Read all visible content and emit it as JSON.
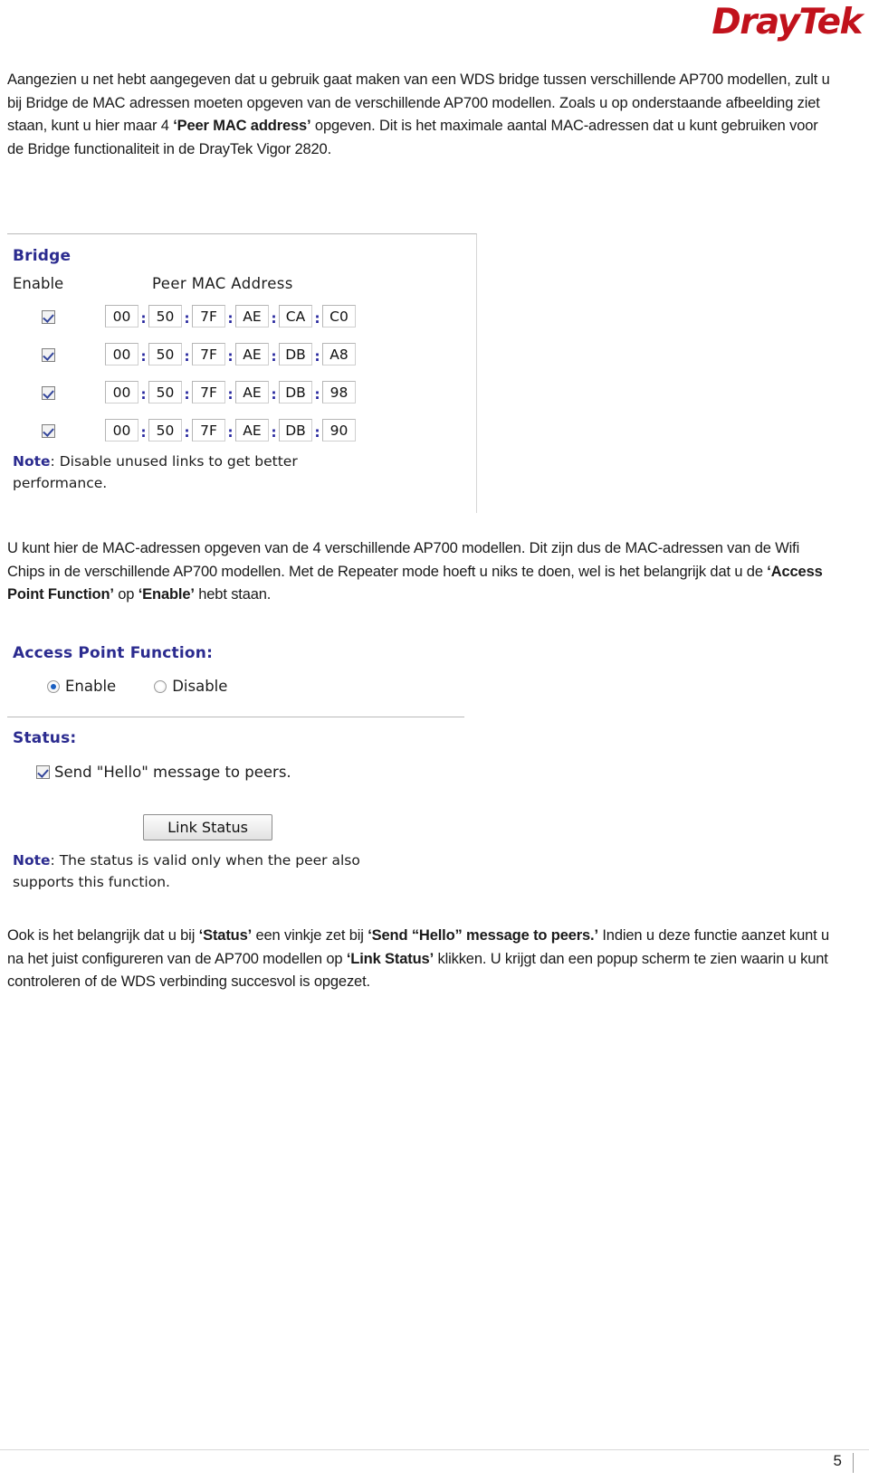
{
  "header": {
    "logo_text": "DrayTek",
    "logo_part_dray": "Dray",
    "logo_part_tek": "Tek",
    "logo_color": "#c1121c"
  },
  "paragraphs": {
    "intro_1": "Aangezien u net hebt aangegeven dat u gebruik gaat maken van een WDS bridge tussen verschillende AP700 modellen, zult u bij Bridge de MAC adressen moeten opgeven van de verschillende AP700 modellen. Zoals u op onderstaande afbeelding ziet staan, kunt u hier maar 4 ",
    "intro_bold_1": "‘Peer MAC address’",
    "intro_2": " opgeven. Dit is het maximale aantal MAC-adressen dat u kunt gebruiken voor de Bridge functionaliteit in de DrayTek Vigor 2820.",
    "mid_1": "U kunt hier de MAC-adressen opgeven van de 4 verschillende AP700 modellen. Dit zijn dus de MAC-adressen van de Wifi Chips in de verschillende AP700 modellen. Met de Repeater mode hoeft u niks te doen, wel is het belangrijk dat u de ",
    "mid_bold_1": "‘Access Point Function’",
    "mid_2": " op ",
    "mid_bold_2": "‘Enable’",
    "mid_3": " hebt staan.",
    "end_1": "Ook is het belangrijk dat u bij ",
    "end_bold_1": "‘Status’",
    "end_2": " een vinkje zet bij ",
    "end_bold_2": "‘Send “Hello” message to peers.’",
    "end_3": " Indien u deze functie aanzet kunt u na het juist configureren van de AP700 modellen op ",
    "end_bold_3": "‘Link Status’",
    "end_4": " klikken. U krijgt dan een popup scherm te zien waarin u kunt controleren of de WDS verbinding succesvol is opgezet."
  },
  "bridge_panel": {
    "title": "Bridge",
    "col_enable": "Enable",
    "col_peer_mac": "Peer MAC Address",
    "separator": ":",
    "rows": [
      {
        "enabled": true,
        "octets": [
          "00",
          "50",
          "7F",
          "AE",
          "CA",
          "C0"
        ]
      },
      {
        "enabled": true,
        "octets": [
          "00",
          "50",
          "7F",
          "AE",
          "DB",
          "A8"
        ]
      },
      {
        "enabled": true,
        "octets": [
          "00",
          "50",
          "7F",
          "AE",
          "DB",
          "98"
        ]
      },
      {
        "enabled": true,
        "octets": [
          "00",
          "50",
          "7F",
          "AE",
          "DB",
          "90"
        ]
      }
    ],
    "note_label": "Note",
    "note_line1": ": Disable unused links to get better",
    "note_line2": "performance."
  },
  "apf_panel": {
    "title": "Access Point Function:",
    "options": [
      {
        "label": "Enable",
        "selected": true
      },
      {
        "label": "Disable",
        "selected": false
      }
    ]
  },
  "status_panel": {
    "title": "Status:",
    "hello_label": "Send \"Hello\" message to peers.",
    "hello_checked": true,
    "link_status_button": "Link Status",
    "note_label": "Note",
    "note_line1": ": The status is valid only when the peer also",
    "note_line2": "supports this function."
  },
  "footer": {
    "page_number": "5"
  }
}
